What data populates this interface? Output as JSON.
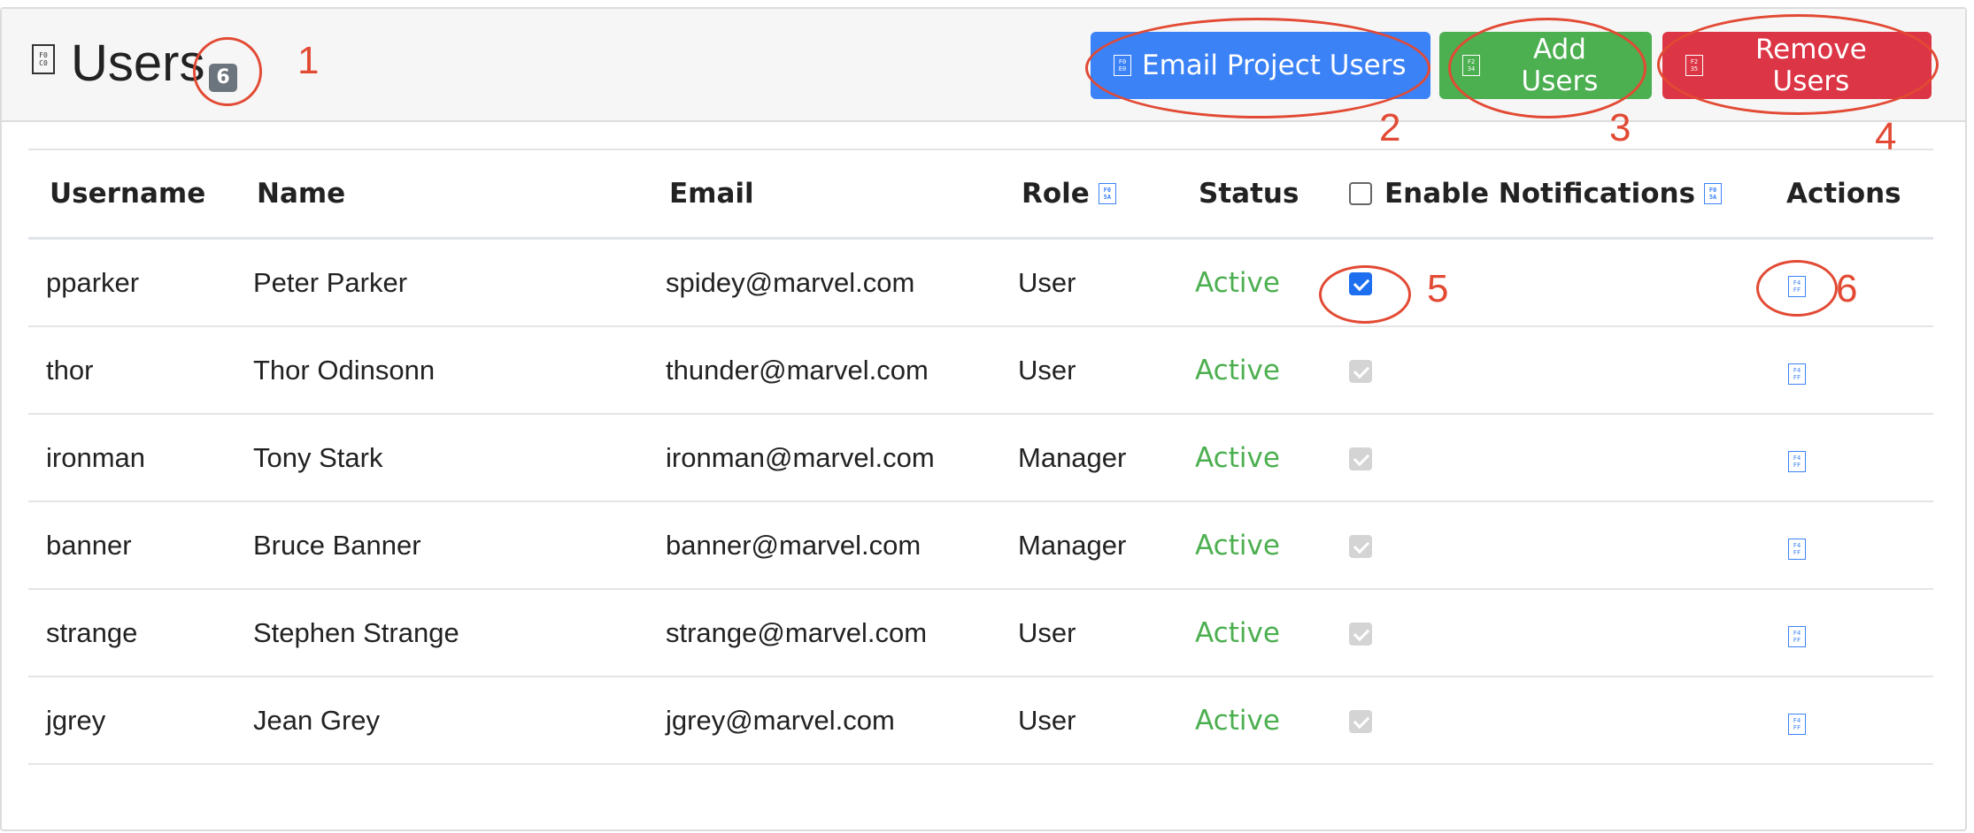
{
  "panel": {
    "icon": "file-icon",
    "icon_glyph": "F0 C0",
    "title": "Users",
    "count": "6"
  },
  "header_buttons": {
    "email": {
      "label": "Email Project Users",
      "icon": "envelope-icon",
      "glyph": "F0 E0"
    },
    "add": {
      "label": "Add Users",
      "icon": "add-user-icon",
      "glyph": "F2 34"
    },
    "remove": {
      "label": "Remove Users",
      "icon": "remove-user-icon",
      "glyph": "F2 35"
    }
  },
  "table": {
    "columns": [
      "Username",
      "Name",
      "Email",
      "Role",
      "Status",
      "Enable Notifications",
      "Actions"
    ],
    "sort_icon_glyph": "F0 5A",
    "action_icon_glyph": "F4 FF",
    "rows": [
      {
        "username": "pparker",
        "name": "Peter Parker",
        "email": "spidey@marvel.com",
        "role": "User",
        "status": "Active",
        "notifications": "checked-active"
      },
      {
        "username": "thor",
        "name": "Thor Odinsonn",
        "email": "thunder@marvel.com",
        "role": "User",
        "status": "Active",
        "notifications": "checked-disabled"
      },
      {
        "username": "ironman",
        "name": "Tony Stark",
        "email": "ironman@marvel.com",
        "role": "Manager",
        "status": "Active",
        "notifications": "checked-disabled"
      },
      {
        "username": "banner",
        "name": "Bruce Banner",
        "email": "banner@marvel.com",
        "role": "Manager",
        "status": "Active",
        "notifications": "checked-disabled"
      },
      {
        "username": "strange",
        "name": "Stephen Strange",
        "email": "strange@marvel.com",
        "role": "User",
        "status": "Active",
        "notifications": "checked-disabled"
      },
      {
        "username": "jgrey",
        "name": "Jean Grey",
        "email": "jgrey@marvel.com",
        "role": "User",
        "status": "Active",
        "notifications": "checked-disabled"
      }
    ]
  },
  "annotations": {
    "color": "#e24a34",
    "labels": [
      "1",
      "2",
      "3",
      "4",
      "5",
      "6"
    ]
  },
  "colors": {
    "primary": "#3b82f6",
    "success": "#4caf50",
    "danger": "#dc3545",
    "badge": "#6c757d"
  }
}
